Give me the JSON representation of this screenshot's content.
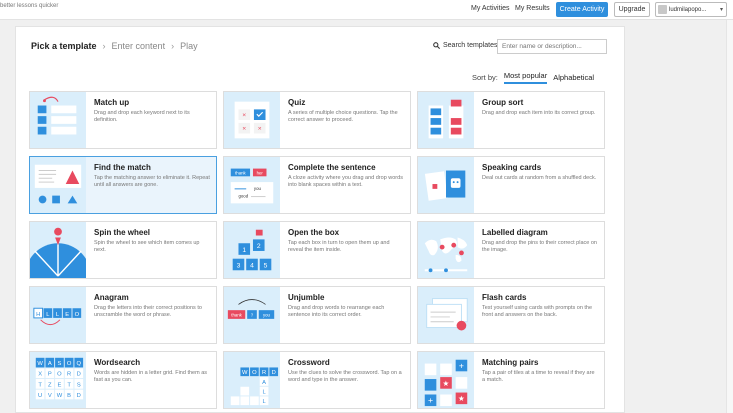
{
  "header": {
    "tagline": "better lessons quicker",
    "my_activities": "My Activities",
    "my_results": "My Results",
    "create": "Create Activity",
    "upgrade": "Upgrade",
    "username": "ludmilapopo..."
  },
  "breadcrumb": {
    "step1": "Pick a template",
    "step2": "Enter content",
    "step3": "Play"
  },
  "search": {
    "label": "Search templates:",
    "placeholder": "Enter name or description..."
  },
  "sort": {
    "label": "Sort by:",
    "popular": "Most popular",
    "alpha": "Alphabetical"
  },
  "templates": [
    {
      "title": "Match up",
      "desc": "Drag and drop each keyword next to its definition."
    },
    {
      "title": "Quiz",
      "desc": "A series of multiple choice questions. Tap the correct answer to proceed."
    },
    {
      "title": "Group sort",
      "desc": "Drag and drop each item into its correct group."
    },
    {
      "title": "Find the match",
      "desc": "Tap the matching answer to eliminate it. Repeat until all answers are gone."
    },
    {
      "title": "Complete the sentence",
      "desc": "A cloze activity where you drag and drop words into blank spaces within a text."
    },
    {
      "title": "Speaking cards",
      "desc": "Deal out cards at random from a shuffled deck."
    },
    {
      "title": "Spin the wheel",
      "desc": "Spin the wheel to see which item comes up next."
    },
    {
      "title": "Open the box",
      "desc": "Tap each box in turn to open them up and reveal the item inside."
    },
    {
      "title": "Labelled diagram",
      "desc": "Drag and drop the pins to their correct place on the image."
    },
    {
      "title": "Anagram",
      "desc": "Drag the letters into their correct positions to unscramble the word or phrase."
    },
    {
      "title": "Unjumble",
      "desc": "Drag and drop words to rearrange each sentence into its correct order."
    },
    {
      "title": "Flash cards",
      "desc": "Test yourself using cards with prompts on the front and answers on the back."
    },
    {
      "title": "Wordsearch",
      "desc": "Words are hidden in a letter grid. Find them as fast as you can."
    },
    {
      "title": "Crossword",
      "desc": "Use the clues to solve the crossword. Tap on a word and type in the answer."
    },
    {
      "title": "Matching pairs",
      "desc": "Tap a pair of tiles at a time to reveal if they are a match."
    }
  ],
  "thumb_text": {
    "complete_words": [
      "thank",
      "her",
      "you",
      "good"
    ],
    "open_box_numbers": [
      "1",
      "2",
      "3",
      "4",
      "5"
    ],
    "anagram_letters": [
      "H",
      "L",
      "L",
      "E",
      "O"
    ],
    "unjumble_words": [
      "thank",
      "?",
      "you"
    ],
    "wordsearch_letters": [
      "W",
      "A",
      "S",
      "O",
      "Q",
      "X",
      "P",
      "O",
      "R",
      "D",
      "T",
      "Z",
      "E",
      "T",
      "S",
      "U",
      "V",
      "W",
      "B",
      "D"
    ],
    "crossword_letters": [
      "W",
      "O",
      "R",
      "D",
      "A",
      "L",
      "L"
    ]
  },
  "colors": {
    "accent": "#2f8fdd",
    "red": "#e84a5f",
    "thumb_bg": "#daeefb"
  }
}
